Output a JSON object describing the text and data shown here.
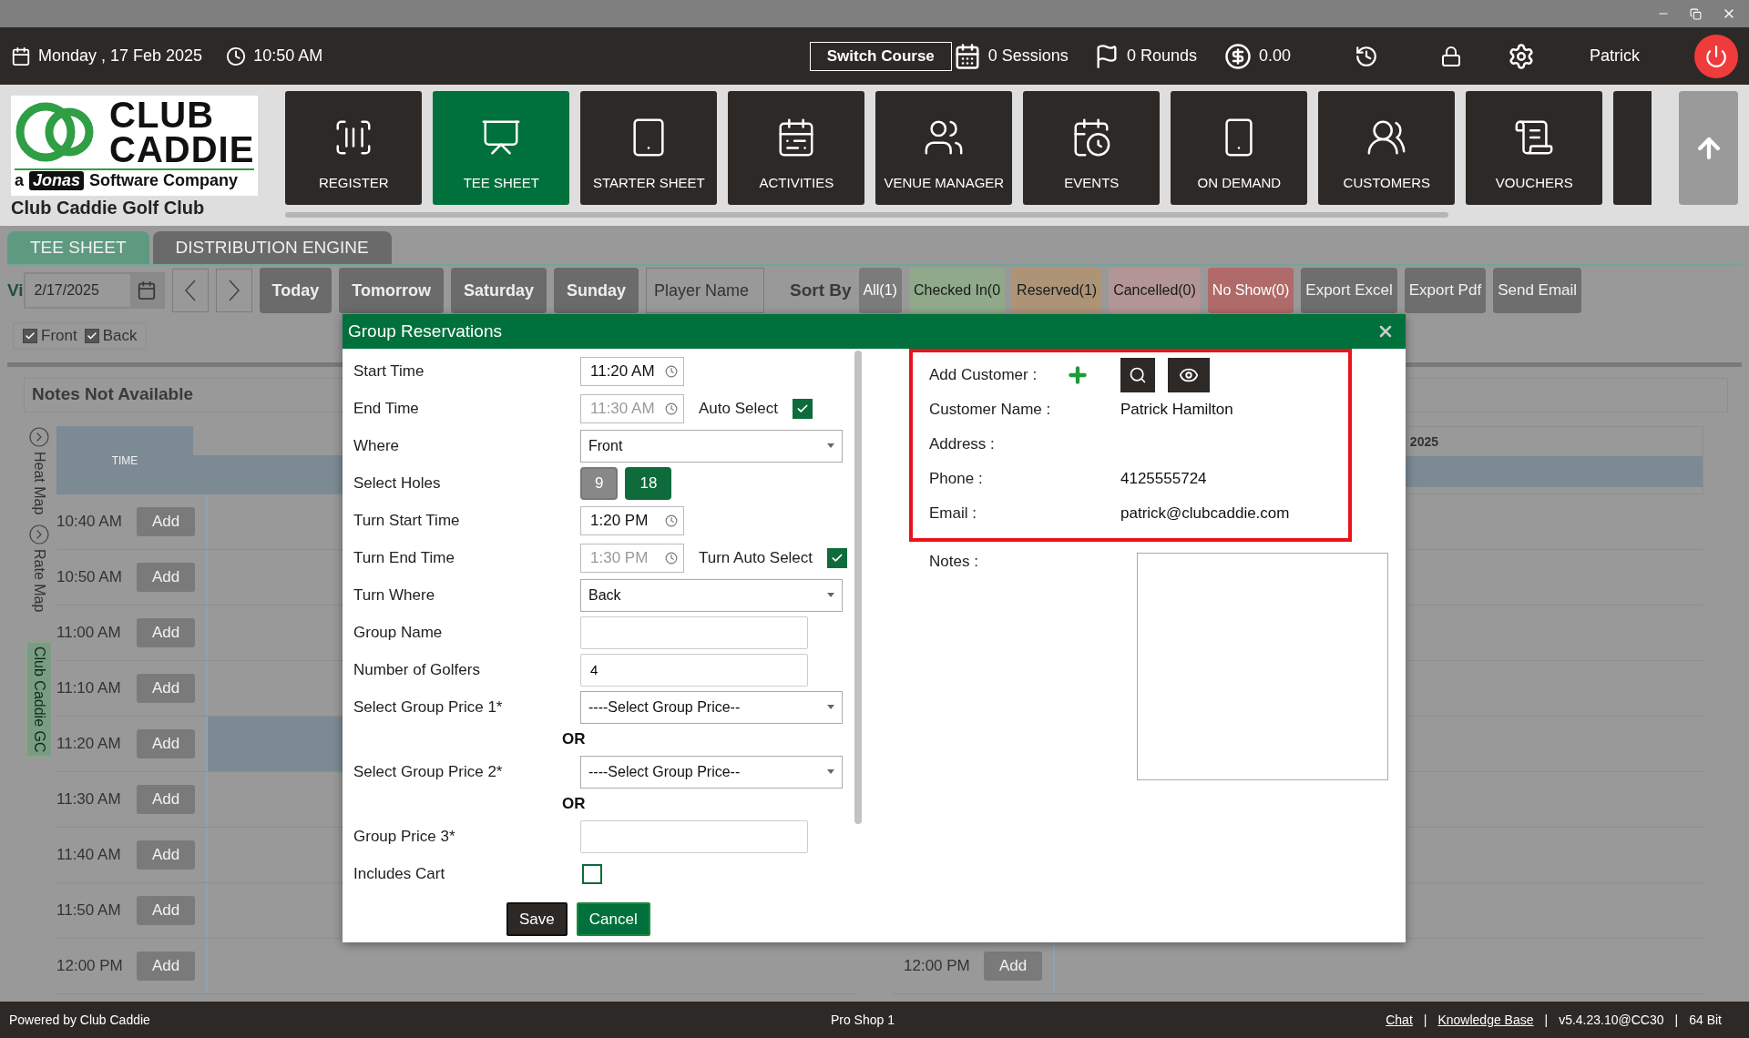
{
  "header": {
    "date": "Monday , 17 Feb 2025",
    "time": "10:50 AM",
    "switch_course": "Switch Course",
    "sessions": "0 Sessions",
    "rounds": "0 Rounds",
    "balance": "0.00",
    "user": "Patrick"
  },
  "logo": {
    "word1": "CLUB",
    "word2": "CADDIE",
    "prefix": "a",
    "brand": "Jonas",
    "tagline": "Software Company",
    "club_name": "Club Caddie Golf Club"
  },
  "nav": [
    {
      "label": "REGISTER",
      "selected": false
    },
    {
      "label": "TEE SHEET",
      "selected": true
    },
    {
      "label": "STARTER SHEET",
      "selected": false
    },
    {
      "label": "ACTIVITIES",
      "selected": false
    },
    {
      "label": "VENUE MANAGER",
      "selected": false
    },
    {
      "label": "EVENTS",
      "selected": false
    },
    {
      "label": "ON DEMAND",
      "selected": false
    },
    {
      "label": "CUSTOMERS",
      "selected": false
    },
    {
      "label": "VOUCHERS",
      "selected": false
    }
  ],
  "tabs": [
    {
      "label": "TEE SHEET",
      "selected": true
    },
    {
      "label": "DISTRIBUTION ENGINE",
      "selected": false
    }
  ],
  "toolbar": {
    "view_label": "Vi",
    "date": "2/17/2025",
    "days": [
      "Today",
      "Tomorrow",
      "Saturday",
      "Sunday"
    ],
    "player_placeholder": "Player Name",
    "sort_label": "Sort By",
    "filters": [
      {
        "label": "All(1)",
        "color": "#7b7b7b"
      },
      {
        "label": "Checked In(0",
        "color": "#8fa98a"
      },
      {
        "label": "Reserved(1)",
        "color": "#ad9477"
      },
      {
        "label": "Cancelled(0)",
        "color": "#b39595"
      },
      {
        "label": "No Show(0)",
        "color": "#b06a6a"
      }
    ],
    "actions": [
      "Export Excel",
      "Export Pdf",
      "Send Email"
    ]
  },
  "course_filters": [
    {
      "label": "Front",
      "checked": true
    },
    {
      "label": "Back",
      "checked": true
    }
  ],
  "notes_banner": "Notes Not Available",
  "side_tabs": [
    {
      "label": "Heat Map",
      "kind": "toggle"
    },
    {
      "label": "Rate Map",
      "kind": "toggle"
    },
    {
      "label": "Club Caddie GC",
      "kind": "course"
    }
  ],
  "tee_sheet": {
    "time_header": "TIME",
    "rows": [
      {
        "time": "10:40 AM",
        "add": "Add",
        "booked": false
      },
      {
        "time": "10:50 AM",
        "add": "Add",
        "booked": false
      },
      {
        "time": "11:00 AM",
        "add": "Add",
        "booked": false
      },
      {
        "time": "11:10 AM",
        "add": "Add",
        "booked": false
      },
      {
        "time": "11:20 AM",
        "add": "Add",
        "booked": true
      },
      {
        "time": "11:30 AM",
        "add": "Add",
        "booked": false
      },
      {
        "time": "11:40 AM",
        "add": "Add",
        "booked": false
      },
      {
        "time": "11:50 AM",
        "add": "Add",
        "booked": false
      },
      {
        "time": "12:00 PM",
        "add": "Add",
        "booked": false
      }
    ]
  },
  "second_sheet": {
    "date_header": "2025",
    "rows": [
      {
        "time": "12:00 PM",
        "add": "Add"
      }
    ]
  },
  "dialog": {
    "title": "Group Reservations",
    "fields": [
      {
        "kind": "time",
        "label": "Start Time",
        "value": "11:20 AM",
        "disabled": false
      },
      {
        "kind": "time",
        "label": "End Time",
        "value": "11:30 AM",
        "disabled": true,
        "toggle": {
          "label": "Auto Select",
          "checked": true
        }
      },
      {
        "kind": "select",
        "label": "Where",
        "value": "Front"
      },
      {
        "kind": "holes",
        "label": "Select Holes",
        "options": [
          {
            "label": "9",
            "selected": false
          },
          {
            "label": "18",
            "selected": true
          }
        ]
      },
      {
        "kind": "time",
        "label": "Turn Start Time",
        "value": "1:20 PM",
        "disabled": false
      },
      {
        "kind": "time",
        "label": "Turn End Time",
        "value": "1:30 PM",
        "disabled": true,
        "toggle": {
          "label": "Turn Auto Select",
          "checked": true
        }
      },
      {
        "kind": "select",
        "label": "Turn Where",
        "value": "Back"
      },
      {
        "kind": "text",
        "label": "Group Name"
      },
      {
        "kind": "text",
        "label": "Number of Golfers",
        "value": "4"
      },
      {
        "kind": "select",
        "label": "Select Group Price 1*",
        "value": "----Select Group Price--"
      },
      {
        "kind": "or",
        "label": "OR"
      },
      {
        "kind": "select",
        "label": "Select Group Price 2*",
        "value": "----Select Group Price--"
      },
      {
        "kind": "or",
        "label": "OR"
      },
      {
        "kind": "text",
        "label": "Group Price 3*"
      },
      {
        "kind": "checkbox",
        "label": "Includes Cart",
        "checked": false
      }
    ],
    "buttons": [
      {
        "label": "Save",
        "kind": "primary"
      },
      {
        "label": "Cancel",
        "kind": "secondary"
      }
    ],
    "customer": {
      "highlighted": true,
      "add_label": "Add Customer :",
      "rows": [
        {
          "label": "Customer Name :",
          "value": "Patrick Hamilton"
        },
        {
          "label": "Address :"
        },
        {
          "label": "Phone :",
          "value": "4125555724"
        },
        {
          "label": "Email :",
          "value": "patrick@clubcaddie.com"
        }
      ]
    },
    "notes_label": "Notes :"
  },
  "footer": {
    "powered": "Powered by Club Caddie",
    "station": "Pro Shop 1",
    "items": [
      {
        "kind": "link",
        "text": "Chat"
      },
      {
        "kind": "sep",
        "text": "|"
      },
      {
        "kind": "link",
        "text": "Knowledge Base"
      },
      {
        "kind": "sep",
        "text": "|"
      },
      {
        "kind": "text",
        "text": "v5.4.23.10@CC30"
      },
      {
        "kind": "sep",
        "text": "|"
      },
      {
        "kind": "text",
        "text": "64 Bit"
      }
    ]
  }
}
